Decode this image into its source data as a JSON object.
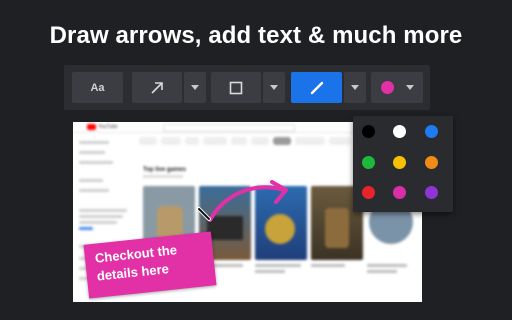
{
  "headline": "Draw arrows, add text & much more",
  "toolbar": {
    "text_tool_label": "Aa",
    "active_tool": "pencil",
    "current_color": "#e230a7",
    "accent_color": "#1a73e8",
    "icons": [
      "text-tool",
      "arrow-icon",
      "rectangle-icon",
      "pencil-icon",
      "color-dot"
    ]
  },
  "palette": {
    "colors": [
      "#000000",
      "#ffffff",
      "#1e7bf0",
      "#1db93a",
      "#f6c000",
      "#f08a18",
      "#e8232a",
      "#d92fa6",
      "#8f35d6"
    ]
  },
  "screenshot": {
    "site_name": "YouTube",
    "shelf_title": "Top live games",
    "background_color": "#ffffff"
  },
  "annotation": {
    "note_line1": "Checkout the",
    "note_line2": "details here",
    "note_color": "#e230a7"
  }
}
